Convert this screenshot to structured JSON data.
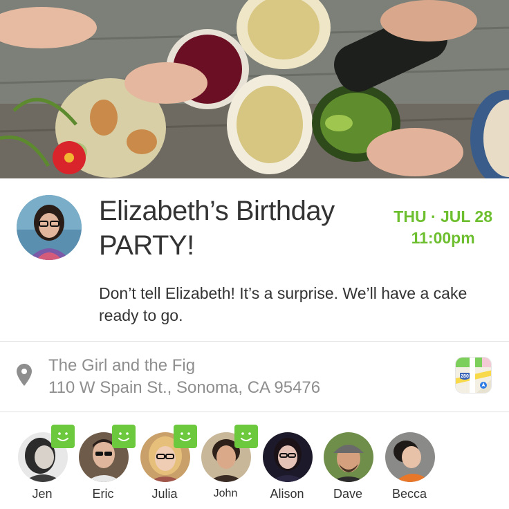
{
  "event": {
    "title": "Elizabeth’s Birthday PARTY!",
    "day_date": "THU · JUL 28",
    "time": "11:00pm",
    "description": "Don’t tell Elizabeth! It’s a surprise. We’ll have a cake ready to go.",
    "accent_color": "#6dbf2f"
  },
  "location": {
    "venue": "The Girl and the Fig",
    "address": "110 W Spain St., Sonoma, CA 95476",
    "pin_icon": "map-pin-icon",
    "maps_icon": "maps-app-icon",
    "maps_route_label": "280"
  },
  "guests": [
    {
      "name": "Jen",
      "accepted": true
    },
    {
      "name": "Eric",
      "accepted": true
    },
    {
      "name": "Julia",
      "accepted": true
    },
    {
      "name": "John",
      "accepted": true
    },
    {
      "name": "Alison",
      "accepted": false
    },
    {
      "name": "Dave",
      "accepted": false
    },
    {
      "name": "Becca",
      "accepted": false
    }
  ],
  "badge_color": "#6cc93d"
}
